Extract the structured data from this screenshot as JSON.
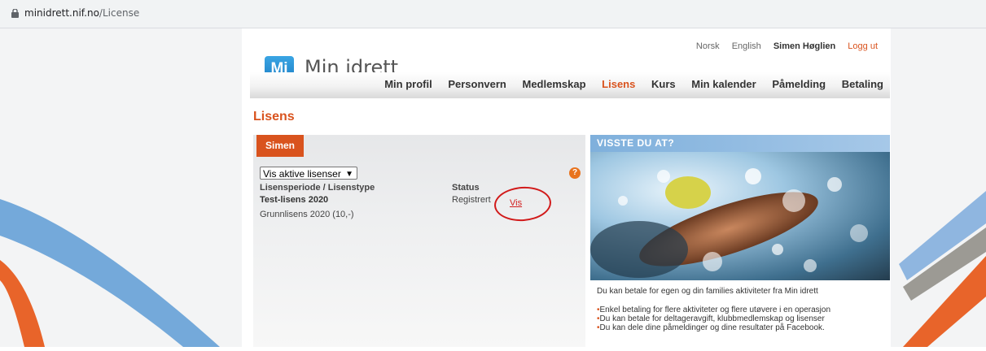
{
  "browser": {
    "url_host": "minidrett.nif.no",
    "url_path": "/License"
  },
  "header": {
    "logo_mark": "Mi",
    "logo_text": "Min idrett",
    "toplinks": {
      "norsk": "Norsk",
      "english": "English",
      "user": "Simen Høglien",
      "logout": "Logg ut"
    },
    "nav": [
      "Min profil",
      "Personvern",
      "Medlemskap",
      "Lisens",
      "Kurs",
      "Min kalender",
      "Påmelding",
      "Betaling"
    ],
    "active_nav": "Lisens"
  },
  "page": {
    "title": "Lisens"
  },
  "license_panel": {
    "tab": "Simen",
    "filter_value": "Vis aktive lisenser",
    "help_icon": "?",
    "columns": {
      "period_type": "Lisensperiode / Lisenstype",
      "status": "Status"
    },
    "rows": [
      {
        "name": "Test-lisens 2020",
        "status": "Registrert",
        "action": "Vis"
      },
      {
        "name": "Grunnlisens 2020 (10,-)"
      }
    ]
  },
  "info_panel": {
    "heading": "VISSTE DU AT?",
    "intro": "Du kan betale for egen og din families aktiviteter fra Min idrett",
    "bullets": [
      "Enkel betaling for flere aktiviteter og flere utøvere i en operasjon",
      "Du kan betale for deltageravgift, klubbmedlemskap og lisenser",
      "Du kan dele dine påmeldinger og dine resultater på Facebook."
    ]
  },
  "colors": {
    "accent": "#d9531e",
    "annotation": "#d11a1a"
  }
}
